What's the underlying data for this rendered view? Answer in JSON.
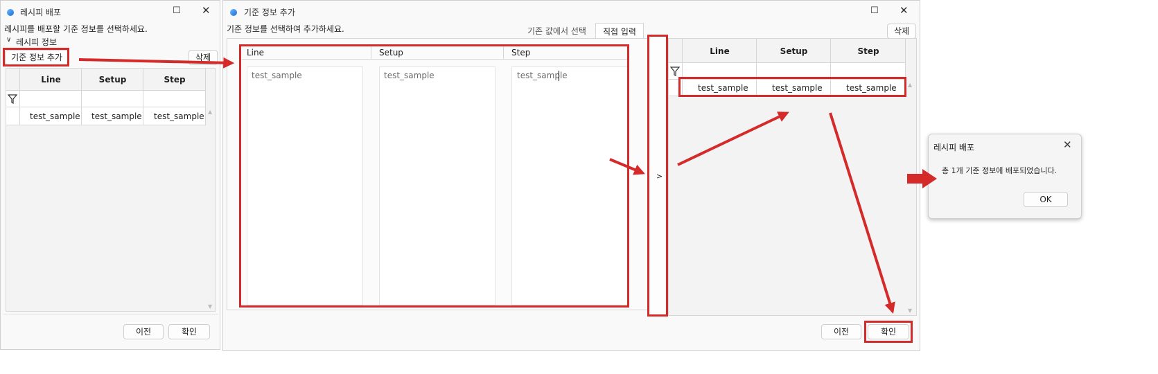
{
  "left_window": {
    "title": "레시피 배포",
    "instruction": "레시피를 배포할 기준 정보를 선택하세요.",
    "section_label": "레시피 정보",
    "add_button": "기준 정보 추가",
    "delete_button": "삭제",
    "columns": [
      "Line",
      "Setup",
      "Step"
    ],
    "rows": [
      [
        "test_sample",
        "test_sample",
        "test_sample"
      ]
    ],
    "prev_button": "이전",
    "confirm_button": "확인"
  },
  "middle_window": {
    "title": "기준 정보 추가",
    "instruction": "기준 정보를 선택하여 추가하세요.",
    "tabs": [
      "기존 값에서 선택",
      "직접 입력"
    ],
    "active_tab": "직접 입력",
    "delete_button": "삭제",
    "input_columns": [
      {
        "label": "Line",
        "value": "test_sample"
      },
      {
        "label": "Setup",
        "value": "test_sample"
      },
      {
        "label": "Step",
        "value": "test_sample"
      }
    ],
    "move_button": ">",
    "result_columns": [
      "Line",
      "Setup",
      "Step"
    ],
    "result_rows": [
      [
        "test_sample",
        "test_sample",
        "test_sample"
      ]
    ],
    "prev_button": "이전",
    "confirm_button": "확인"
  },
  "dialog": {
    "title": "레시피 배포",
    "message": "총 1개 기준 정보에 배포되었습니다.",
    "ok_button": "OK"
  },
  "colors": {
    "annotation_red": "#d42a2a",
    "window_bg": "#f9f9f9",
    "border": "#cfcfcf"
  }
}
